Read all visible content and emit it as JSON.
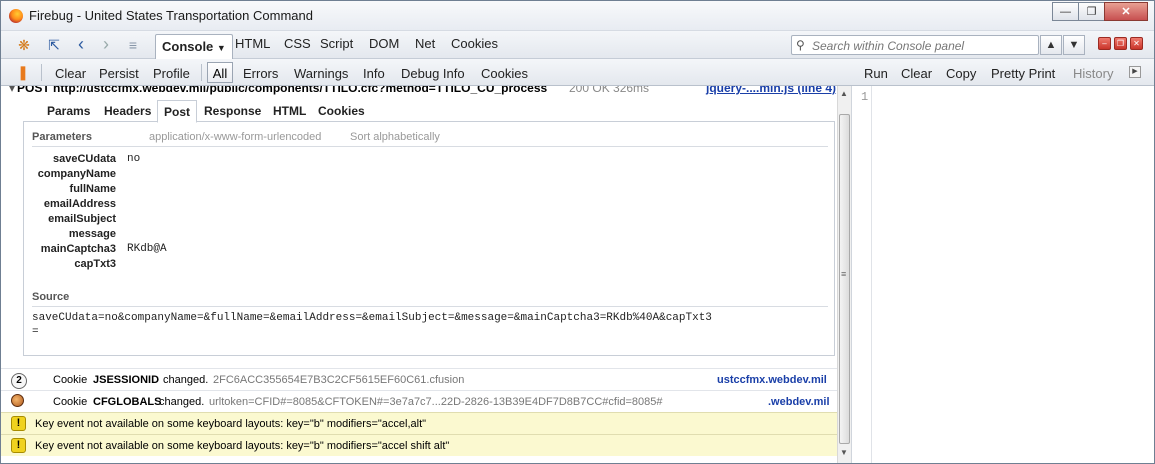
{
  "window": {
    "title": "Firebug - United States Transportation Command"
  },
  "toolbar1": {
    "tabs": [
      "Console",
      "HTML",
      "CSS",
      "Script",
      "DOM",
      "Net",
      "Cookies"
    ],
    "search_placeholder": "Search within Console panel"
  },
  "toolbar2": {
    "left": [
      "Clear",
      "Persist",
      "Profile"
    ],
    "filters": [
      "All",
      "Errors",
      "Warnings",
      "Info",
      "Debug Info",
      "Cookies"
    ],
    "right": [
      "Run",
      "Clear",
      "Copy",
      "Pretty Print",
      "History"
    ]
  },
  "request": {
    "line": "POST http://ustccfmx.webdev.mil/public/components/TTILO.cfc?method=TTILO_CU_process",
    "status": "200 OK 326ms",
    "source": "jquery-....min.js (line 4)"
  },
  "subtabs": [
    "Params",
    "Headers",
    "Post",
    "Response",
    "HTML",
    "Cookies"
  ],
  "params": {
    "section": "Parameters",
    "encoding": "application/x-www-form-urlencoded",
    "sort": "Sort alphabetically",
    "rows": [
      {
        "name": "saveCUdata",
        "value": "no"
      },
      {
        "name": "companyName",
        "value": ""
      },
      {
        "name": "fullName",
        "value": ""
      },
      {
        "name": "emailAddress",
        "value": ""
      },
      {
        "name": "emailSubject",
        "value": ""
      },
      {
        "name": "message",
        "value": ""
      },
      {
        "name": "mainCaptcha3",
        "value": "RKdb@A"
      },
      {
        "name": "capTxt3",
        "value": ""
      }
    ]
  },
  "source": {
    "label": "Source",
    "line1": "saveCUdata=no&companyName=&fullName=&emailAddress=&emailSubject=&message=&mainCaptcha3=RKdb%40A&capTxt3",
    "line2": "="
  },
  "log": [
    {
      "badge": "2",
      "kind": "Cookie",
      "name": "JSESSIONID",
      "action": "changed.",
      "value": "2FC6ACC355654E7B3C2CF5615EF60C61.cfusion",
      "domain": "ustccfmx.webdev.mil"
    },
    {
      "badge": "",
      "kind": "Cookie",
      "name": "CFGLOBALS",
      "action": "changed.",
      "value": "urltoken=CFID#=8085&CFTOKEN#=3e7a7c7...22D-2826-13B39E4DF7D8B7CC#cfid=8085#",
      "domain": ".webdev.mil"
    },
    {
      "warning": "Key event not available on some keyboard layouts: key=\"b\" modifiers=\"accel,alt\""
    },
    {
      "warning": "Key event not available on some keyboard layouts: key=\"b\" modifiers=\"accel shift alt\""
    }
  ],
  "editor": {
    "line_number": "1"
  }
}
